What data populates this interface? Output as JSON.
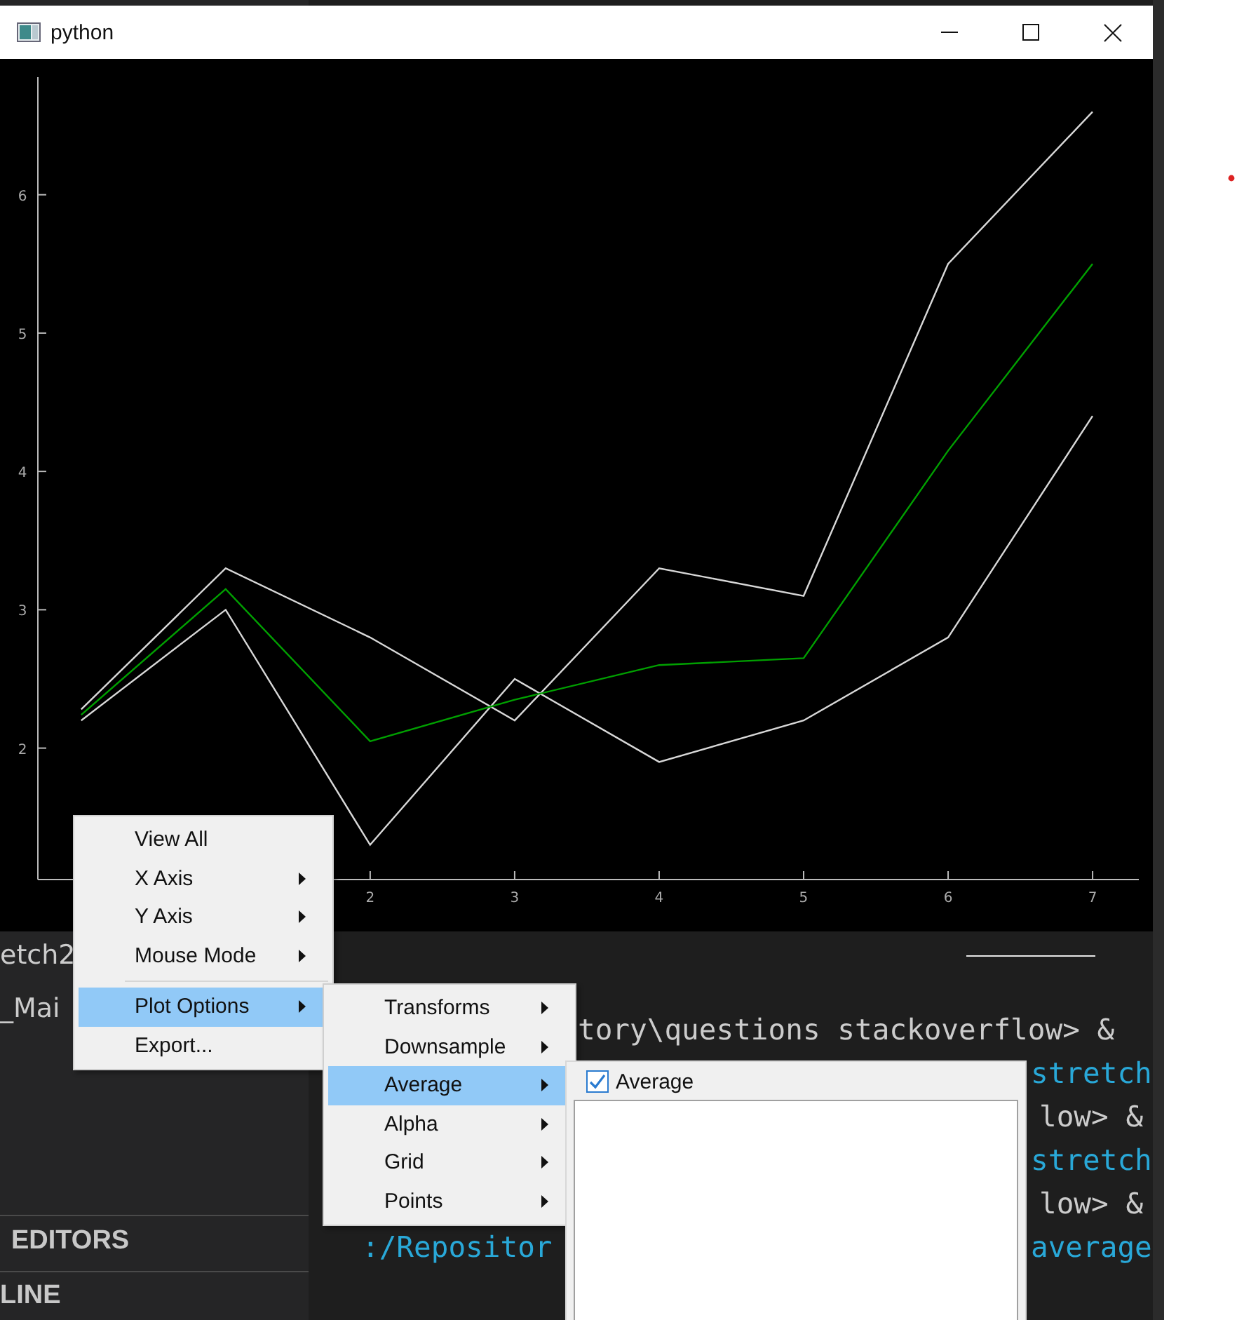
{
  "editor": {
    "sidebar": [
      {
        "text": "etch2",
        "kind": "file"
      },
      {
        "text": "_Mai",
        "kind": "file"
      },
      {
        "text": "EDITORS",
        "kind": "section"
      },
      {
        "text": "LINE",
        "kind": "section"
      }
    ],
    "terminal_lines": [
      {
        "text": "tory\\questions stackoverflow> &",
        "kind": "prompt"
      },
      {
        "text": "stretch",
        "kind": "path"
      },
      {
        "text": "low> &",
        "kind": "prompt"
      },
      {
        "text": "stretch",
        "kind": "path"
      },
      {
        "text": "low> &",
        "kind": "prompt"
      },
      {
        "text": ":/Repositor",
        "kind": "path"
      },
      {
        "text": "average",
        "kind": "path"
      }
    ]
  },
  "window": {
    "title": "python",
    "chart_data": {
      "type": "line",
      "x": [
        0,
        1,
        2,
        3,
        4,
        5,
        6,
        7
      ],
      "xlim": [
        -0.3,
        7.32
      ],
      "ylim": [
        1.05,
        6.85
      ],
      "xticks": [
        2,
        3,
        4,
        5,
        6,
        7
      ],
      "yticks": [
        2,
        3,
        4,
        5,
        6
      ],
      "series": [
        {
          "color": "#d8d8d8",
          "values": [
            2.28,
            3.3,
            2.8,
            2.2,
            3.3,
            3.1,
            5.5,
            6.6
          ]
        },
        {
          "color": "#d8d8d8",
          "values": [
            2.2,
            3.0,
            1.3,
            2.5,
            1.9,
            2.2,
            2.8,
            4.4
          ]
        },
        {
          "color": "#00a000",
          "values": [
            2.24,
            3.15,
            2.05,
            2.35,
            2.6,
            2.65,
            4.15,
            5.5
          ]
        }
      ]
    }
  },
  "context_menu": {
    "items": [
      {
        "label": "View All",
        "has_submenu": false,
        "selected": false,
        "kind": "item"
      },
      {
        "label": "X Axis",
        "has_submenu": true,
        "selected": false,
        "kind": "item"
      },
      {
        "label": "Y Axis",
        "has_submenu": true,
        "selected": false,
        "kind": "item"
      },
      {
        "label": "Mouse Mode",
        "has_submenu": true,
        "selected": false,
        "kind": "item"
      },
      {
        "kind": "separator"
      },
      {
        "label": "Plot Options",
        "has_submenu": true,
        "selected": true,
        "kind": "item"
      },
      {
        "label": "Export...",
        "has_submenu": false,
        "selected": false,
        "kind": "item"
      }
    ]
  },
  "submenu": {
    "items": [
      {
        "label": "Transforms",
        "has_submenu": true,
        "selected": false,
        "kind": "item"
      },
      {
        "label": "Downsample",
        "has_submenu": true,
        "selected": false,
        "kind": "item"
      },
      {
        "label": "Average",
        "has_submenu": true,
        "selected": true,
        "kind": "item"
      },
      {
        "label": "Alpha",
        "has_submenu": true,
        "selected": false,
        "kind": "item"
      },
      {
        "label": "Grid",
        "has_submenu": true,
        "selected": false,
        "kind": "item"
      },
      {
        "label": "Points",
        "has_submenu": true,
        "selected": false,
        "kind": "item"
      }
    ]
  },
  "average_panel": {
    "checkbox": {
      "label": "Average",
      "checked": true
    }
  }
}
